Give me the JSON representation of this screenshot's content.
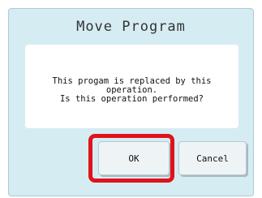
{
  "dialog": {
    "title": "Move Program",
    "message": "This progam is replaced by this operation.\nIs this operation performed?"
  },
  "buttons": {
    "ok_label": "OK",
    "cancel_label": "Cancel"
  },
  "colors": {
    "dialog_background": "#d6ecf3",
    "highlight": "#e0121c"
  }
}
